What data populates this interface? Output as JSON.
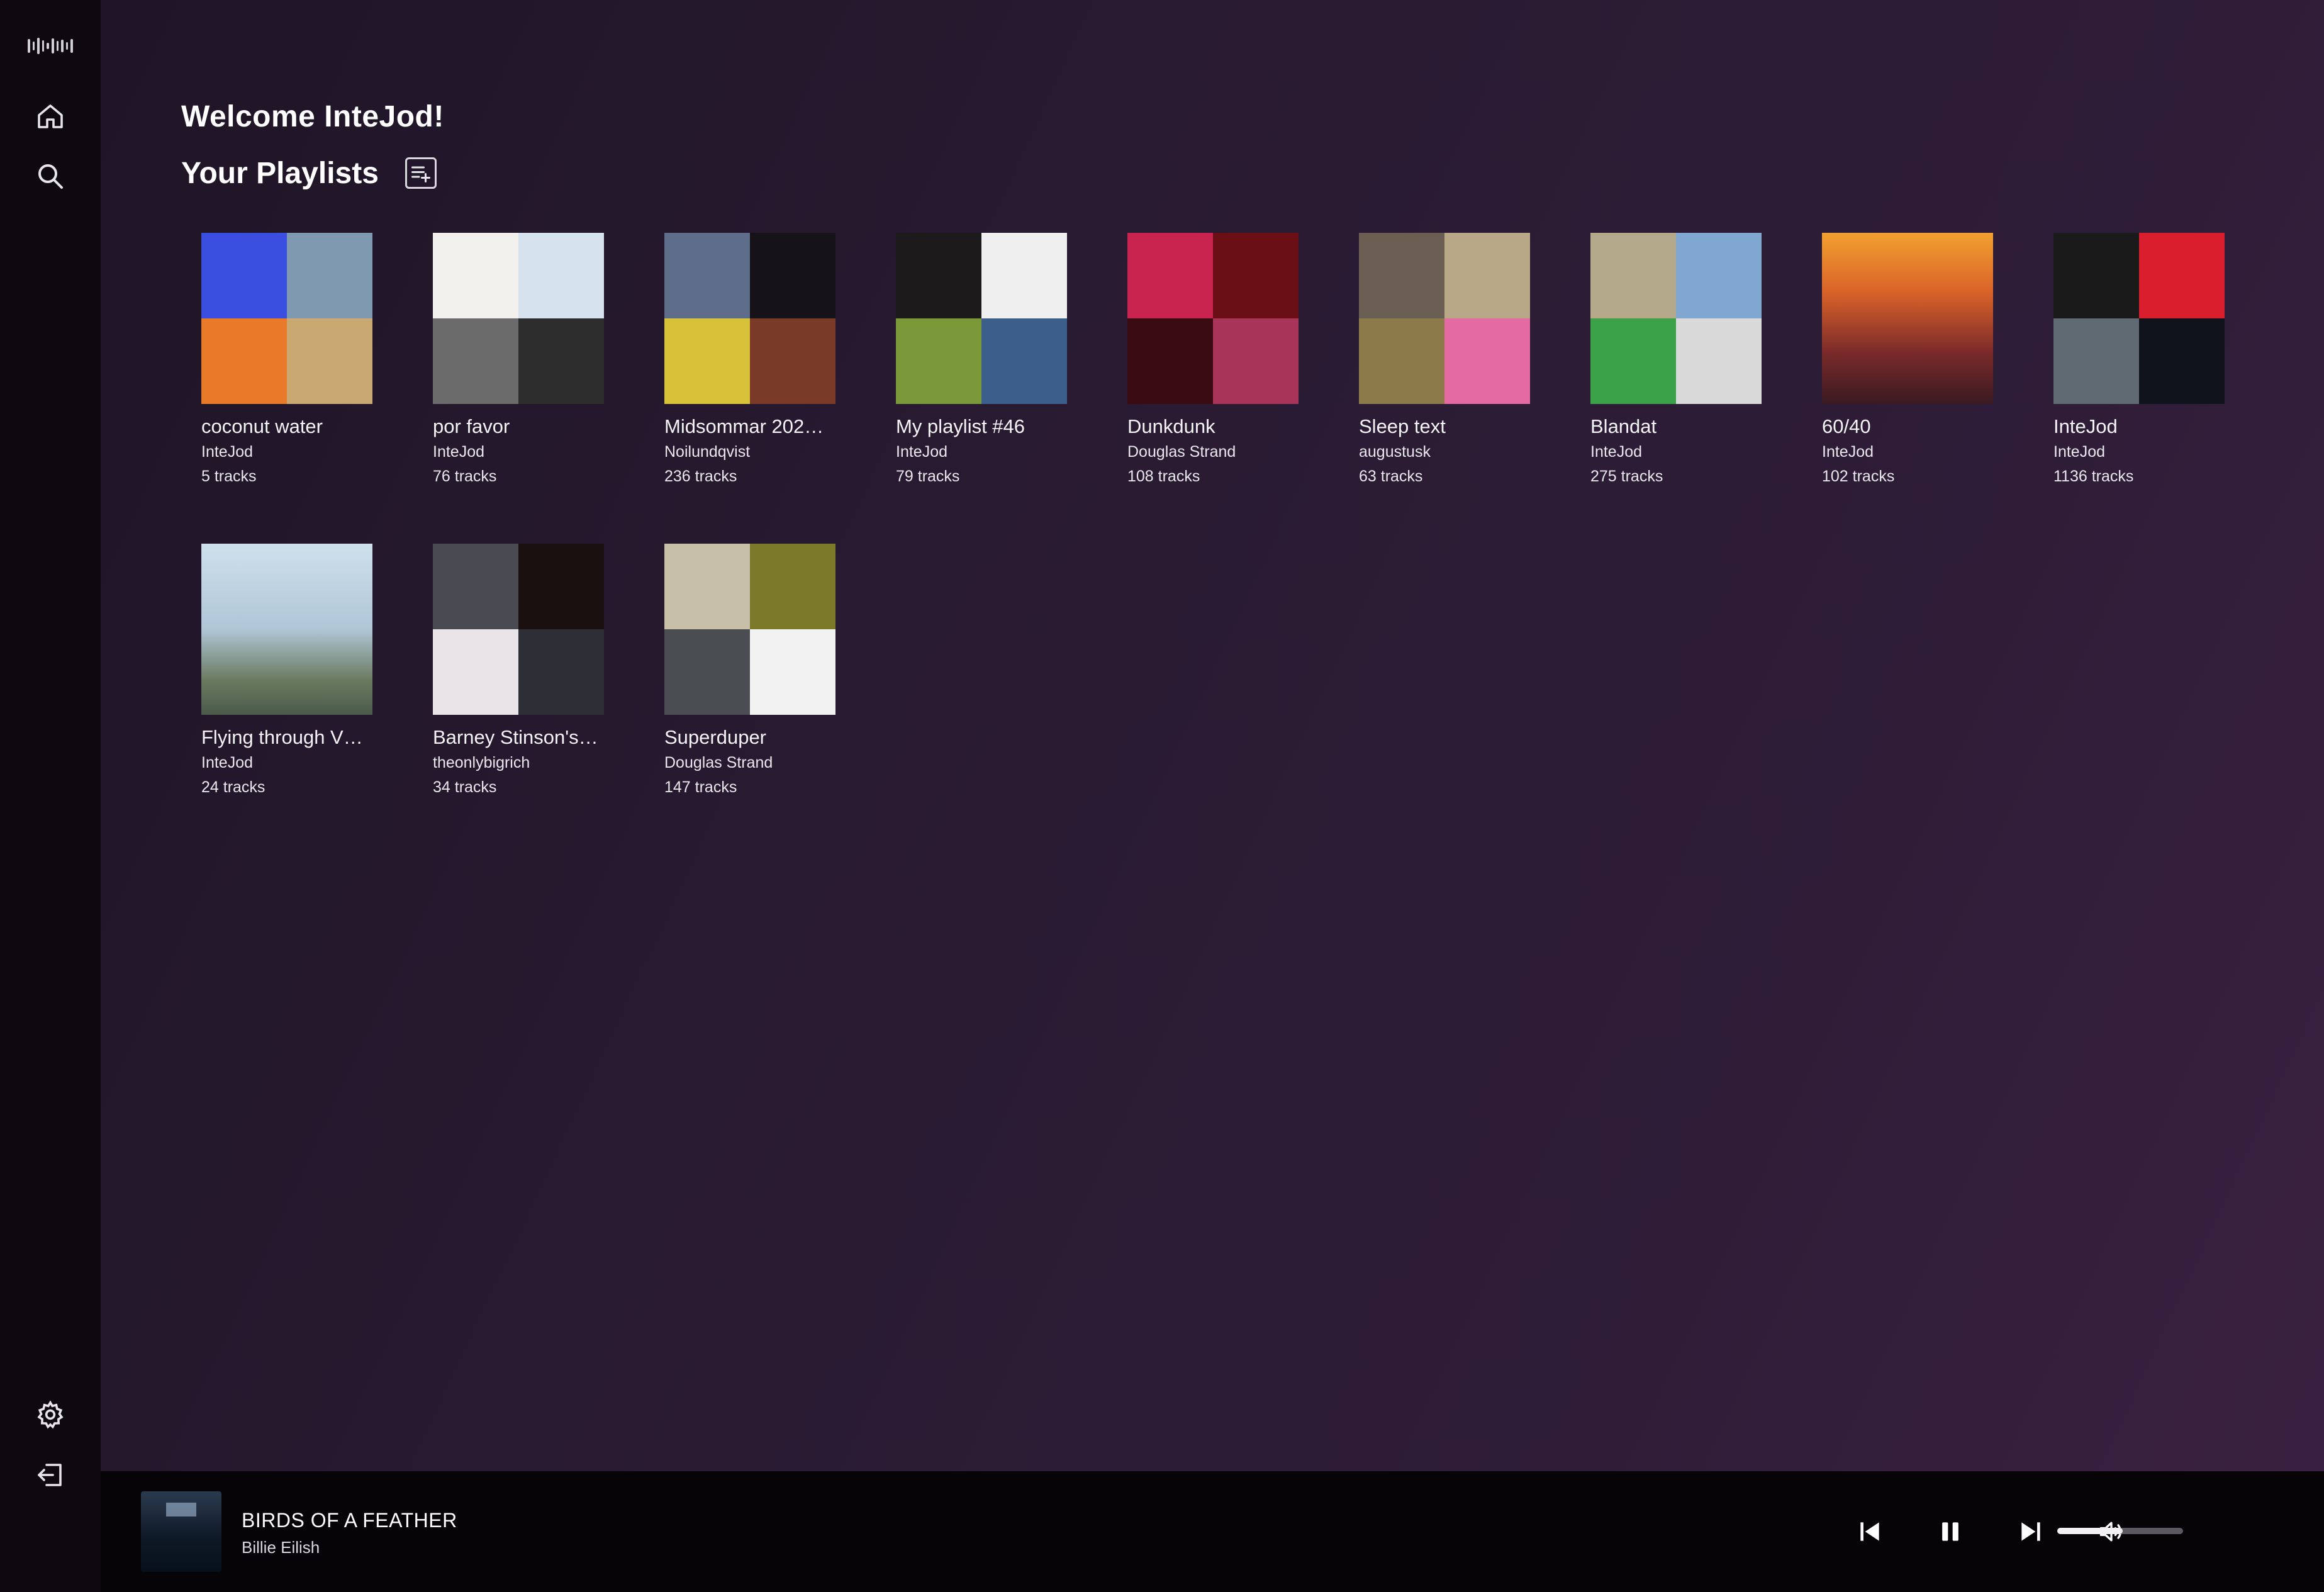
{
  "app": {
    "logo_icon": "waveform-logo-icon"
  },
  "sidebar": {
    "items": [
      {
        "icon": "home-icon"
      },
      {
        "icon": "search-icon"
      },
      {
        "icon": "gear-icon"
      },
      {
        "icon": "logout-icon"
      }
    ]
  },
  "header": {
    "welcome": "Welcome InteJod!",
    "playlists_title": "Your Playlists",
    "add_playlist_icon": "playlist-add-icon"
  },
  "playlists": [
    {
      "title": "coconut water",
      "owner": "InteJod",
      "tracks": "5 tracks",
      "colors": [
        "#3a4fe0",
        "#7f9ab0",
        "#e87a2a",
        "#c9a872"
      ]
    },
    {
      "title": "por favor",
      "owner": "InteJod",
      "tracks": "76 tracks",
      "colors": [
        "#f2f0ec",
        "#d7e2ef",
        "#6b6b6b",
        "#2d2d2d"
      ]
    },
    {
      "title": "Midsommar 202…",
      "owner": "Noilundqvist",
      "tracks": "236 tracks",
      "colors": [
        "#5e6e8a",
        "#161318",
        "#d8c23a",
        "#7a3a28"
      ]
    },
    {
      "title": "My playlist #46",
      "owner": "InteJod",
      "tracks": "79 tracks",
      "colors": [
        "#1c1a1a",
        "#efefef",
        "#7a9a3a",
        "#3b5e8a"
      ]
    },
    {
      "title": "Dunkdunk",
      "owner": "Douglas Strand",
      "tracks": "108 tracks",
      "colors": [
        "#c9234f",
        "#6a0f16",
        "#3a0b12",
        "#a8345a"
      ]
    },
    {
      "title": "Sleep text",
      "owner": "augustusk",
      "tracks": "63 tracks",
      "colors": [
        "#6a5e52",
        "#b9a888",
        "#8c7a4a",
        "#e46aa2"
      ]
    },
    {
      "title": "Blandat",
      "owner": "InteJod",
      "tracks": "275 tracks",
      "colors": [
        "#b4a88a",
        "#7fa7cf",
        "#3ca24a",
        "#d9d9d9"
      ]
    },
    {
      "title": "60/40",
      "owner": "InteJod",
      "tracks": "102 tracks",
      "colors": [
        "#d1622a"
      ]
    },
    {
      "title": "InteJod",
      "owner": "InteJod",
      "tracks": "1136 tracks",
      "colors": [
        "#1a1a1a",
        "#d81e2d",
        "#5f6a72",
        "#10121c"
      ]
    },
    {
      "title": "Flying through V…",
      "owner": "InteJod",
      "tracks": "24 tracks",
      "colors": [
        "#b8cfe0"
      ]
    },
    {
      "title": "Barney Stinson's…",
      "owner": "theonlybigrich",
      "tracks": "34 tracks",
      "colors": [
        "#4a4a52",
        "#1a1010",
        "#e9e4e8",
        "#2e2e36"
      ]
    },
    {
      "title": "Superduper",
      "owner": "Douglas Strand",
      "tracks": "147 tracks",
      "colors": [
        "#c7bfa8",
        "#7c7a2a",
        "#4a4e52",
        "#f2f2f2"
      ]
    }
  ],
  "now_playing": {
    "title": "BIRDS OF A FEATHER",
    "artist": "Billie Eilish",
    "volume_level": 0.52
  },
  "controls": {
    "prev_icon": "skip-previous-icon",
    "pause_icon": "pause-icon",
    "next_icon": "skip-next-icon",
    "volume_icon": "volume-icon"
  }
}
